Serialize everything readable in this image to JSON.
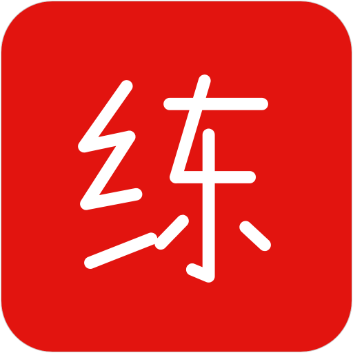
{
  "icon": {
    "character": "练",
    "name": "lian-character-icon",
    "background_color": "#E2140F",
    "glyph_color": "#FFFFFF",
    "shape": "rounded-square"
  }
}
